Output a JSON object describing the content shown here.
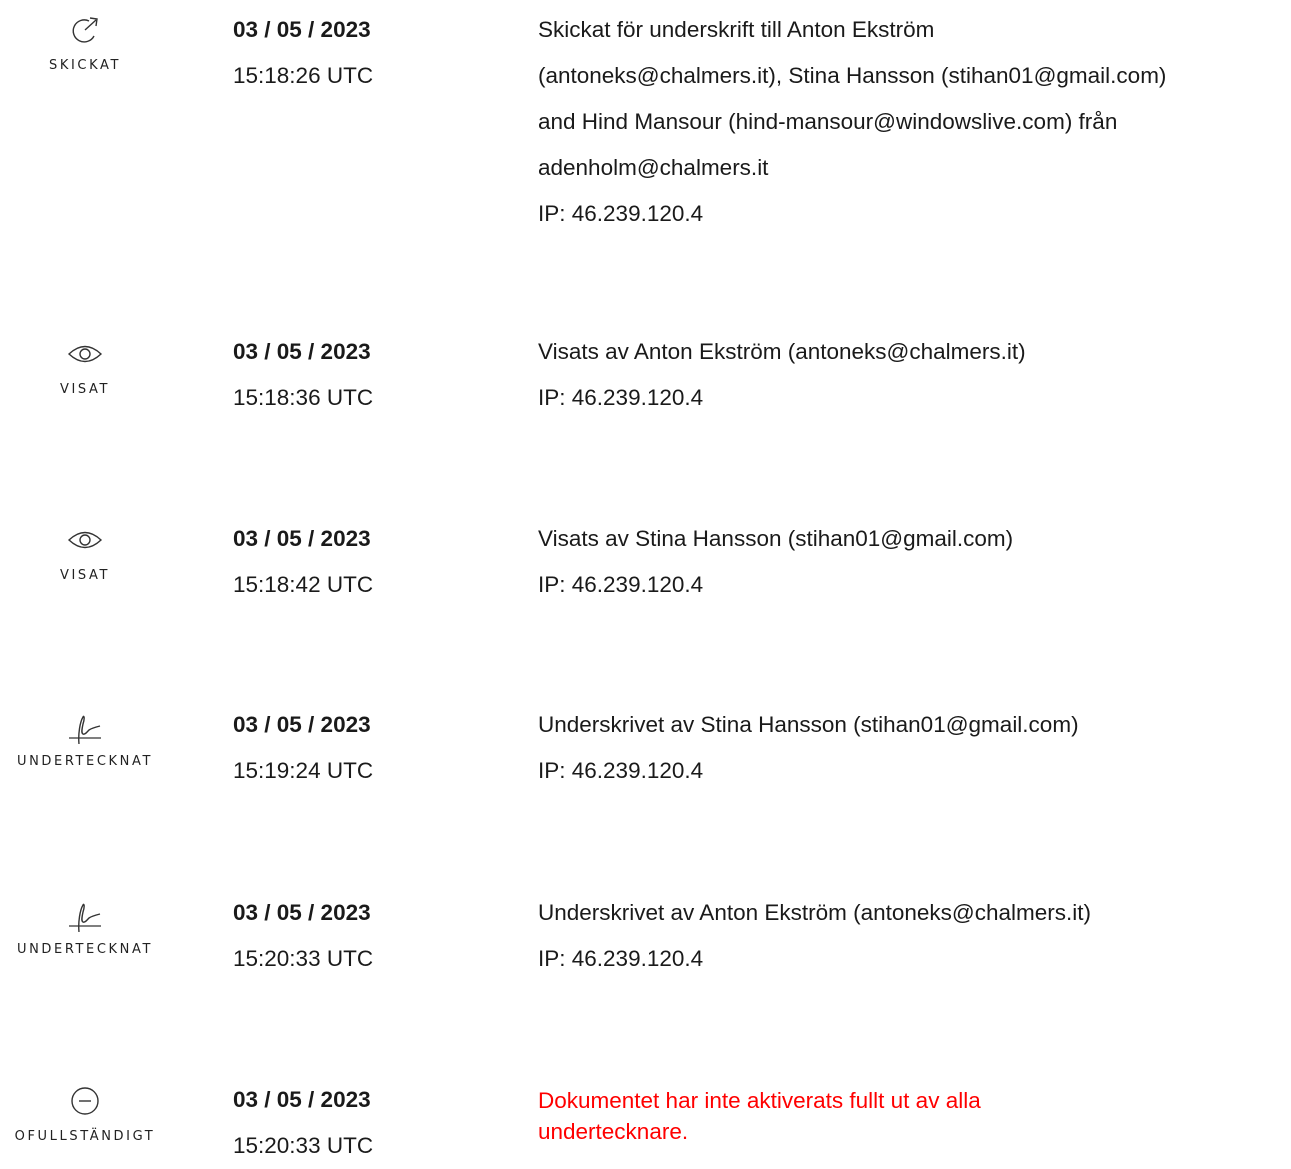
{
  "events": [
    {
      "status": "SKICKAT",
      "icon": "share-arrow-icon",
      "date": "03 / 05 / 2023",
      "time": "15:18:26 UTC",
      "lines": [
        "Skickat för underskrift till Anton Ekström",
        "(antoneks@chalmers.it), Stina Hansson (stihan01@gmail.com)",
        "and Hind Mansour (hind-mansour@windowslive.com) från",
        "adenholm@chalmers.it",
        "IP: 46.239.120.4"
      ]
    },
    {
      "status": "VISAT",
      "icon": "eye-icon",
      "date": "03 / 05 / 2023",
      "time": "15:18:36 UTC",
      "lines": [
        "Visats av Anton Ekström (antoneks@chalmers.it)",
        "IP: 46.239.120.4"
      ]
    },
    {
      "status": "VISAT",
      "icon": "eye-icon",
      "date": "03 / 05 / 2023",
      "time": "15:18:42 UTC",
      "lines": [
        "Visats av Stina Hansson (stihan01@gmail.com)",
        "IP: 46.239.120.4"
      ]
    },
    {
      "status": "UNDERTECKNAT",
      "icon": "signature-icon",
      "date": "03 / 05 / 2023",
      "time": "15:19:24 UTC",
      "lines": [
        "Underskrivet av Stina Hansson (stihan01@gmail.com)",
        "IP: 46.239.120.4"
      ]
    },
    {
      "status": "UNDERTECKNAT",
      "icon": "signature-icon",
      "date": "03 / 05 / 2023",
      "time": "15:20:33 UTC",
      "lines": [
        "Underskrivet av Anton Ekström (antoneks@chalmers.it)",
        "IP: 46.239.120.4"
      ]
    },
    {
      "status": "OFULLSTÄNDIGT",
      "icon": "minus-circle-icon",
      "date": "03 / 05 / 2023",
      "time": "15:20:33 UTC",
      "lines": [
        "Dokumentet har inte aktiverats fullt ut av alla undertecknare."
      ],
      "warning_color": "#ff0000"
    }
  ]
}
